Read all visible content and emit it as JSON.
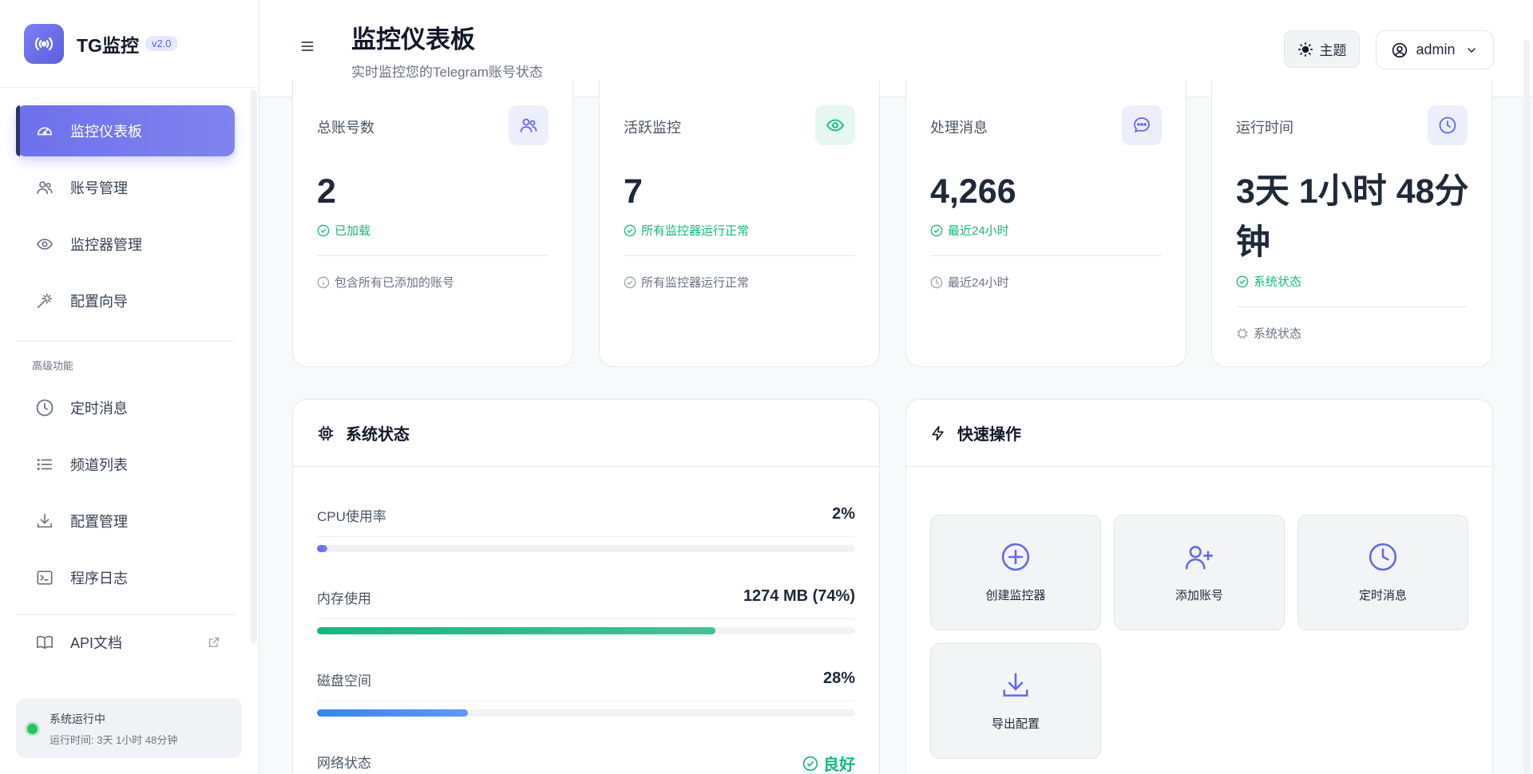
{
  "brand": {
    "name": "TG监控",
    "version": "v2.0"
  },
  "sidebar": {
    "items": [
      {
        "label": "监控仪表板",
        "active": true
      },
      {
        "label": "账号管理"
      },
      {
        "label": "监控器管理"
      },
      {
        "label": "配置向导"
      }
    ],
    "section_title": "高级功能",
    "advanced": [
      {
        "label": "定时消息"
      },
      {
        "label": "频道列表"
      },
      {
        "label": "配置管理"
      },
      {
        "label": "程序日志"
      }
    ],
    "api_docs": "API文档",
    "status": {
      "title": "系统运行中",
      "uptime": "运行时间: 3天 1小时 48分钟"
    }
  },
  "header": {
    "title": "监控仪表板",
    "subtitle": "实时监控您的Telegram账号状态",
    "theme_label": "主题",
    "user": "admin"
  },
  "stats": [
    {
      "label": "总账号数",
      "value": "2",
      "status": "已加载",
      "note": "包含所有已添加的账号",
      "icon": "users-icon"
    },
    {
      "label": "活跃监控",
      "value": "7",
      "status": "所有监控器运行正常",
      "note": "所有监控器运行正常",
      "icon": "eye-icon"
    },
    {
      "label": "处理消息",
      "value": "4,266",
      "status": "最近24小时",
      "note": "最近24小时",
      "icon": "message-icon"
    },
    {
      "label": "运行时间",
      "value": "3天 1小时 48分钟",
      "status": "系统状态",
      "note": "系统状态",
      "icon": "clock-icon"
    }
  ],
  "system": {
    "title": "系统状态",
    "cpu": {
      "label": "CPU使用率",
      "value": "2%",
      "percent": 2
    },
    "memory": {
      "label": "内存使用",
      "value": "1274 MB (74%)",
      "percent": 74
    },
    "disk": {
      "label": "磁盘空间",
      "value": "28%",
      "percent": 28
    },
    "network": {
      "label": "网络状态",
      "value": "良好"
    }
  },
  "quick": {
    "title": "快速操作",
    "actions": [
      {
        "label": "创建监控器",
        "icon": "plus-circle-icon"
      },
      {
        "label": "添加账号",
        "icon": "user-plus-icon"
      },
      {
        "label": "定时消息",
        "icon": "clock-icon"
      },
      {
        "label": "导出配置",
        "icon": "download-icon"
      }
    ]
  },
  "colors": {
    "accent": "#6366f1",
    "success": "#10b981",
    "cpu_bar": "#6366f1",
    "memory_bar": "#10b981",
    "disk_bar": "#3b82f6"
  }
}
